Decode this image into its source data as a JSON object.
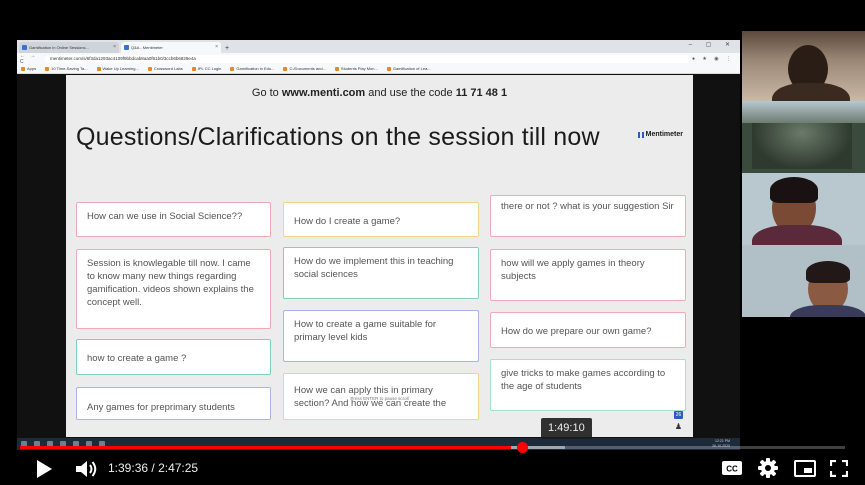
{
  "browser": {
    "tabs": [
      "Gamification in Online Sessions...",
      "Q&A - Mentimeter"
    ],
    "new_tab": "+",
    "window_controls": "–  ▢  ✕",
    "nav": "← → C",
    "url": "mentimeter.com/s/6f3da1293ac4109f9bbdcab8aa0f61b0/3ccb6b6829e4a",
    "extensions": "● ★ ◉ ⋮",
    "bookmarks": [
      "Apps",
      "10 Time-Saving Ta...",
      "Wake Up Learning...",
      "Crossword Labs",
      "IPL CC Login",
      "Gamification in Edu...",
      "C:/Documents and...",
      "Students Play Mon...",
      "Gamification of Lea..."
    ]
  },
  "slide": {
    "code_prefix": "Go to ",
    "code_site": "www.menti.com",
    "code_middle": " and use the code ",
    "code_value": "11 71 48 1",
    "title": "Questions/Clarifications on the session till now",
    "brand": "Mentimeter",
    "enter_hint": "Press ENTER to pause scroll",
    "slide_count": "26",
    "person_icon": "♟"
  },
  "cards": [
    {
      "text": "How can we use in Social Science??",
      "color": "c-red"
    },
    {
      "text": "Session is knowlegable till now. I came to know many new things regarding gamification. videos shown explains the concept well.",
      "color": "c-red"
    },
    {
      "text": "how to create a game ?",
      "color": "c-teal"
    },
    {
      "text": "Any games for preprimary students",
      "color": "c-blue"
    },
    {
      "text": "How do I create a game?",
      "color": "c-yellow"
    },
    {
      "text": "How do we implement this in teaching social sciences",
      "color": "c-teal"
    },
    {
      "text": "How to create a game suitable for primary level kids",
      "color": "c-blue"
    },
    {
      "text": "How we can apply this in primary section? And how we can create the",
      "color": "c-yellow"
    },
    {
      "text": "there or not ? what is your suggestion Sir",
      "color": "c-red"
    },
    {
      "text": "how will we apply games in theory subjects",
      "color": "c-red"
    },
    {
      "text": "How do we prepare our own game?",
      "color": "c-red"
    },
    {
      "text": "give tricks to make games according to the age of students",
      "color": "c-mint"
    }
  ],
  "taskbar": {
    "clock": "12:21 PM\n26-10-2020"
  },
  "player": {
    "hover_time": "1:49:10",
    "current_time": "1:39:36",
    "separator": " / ",
    "duration": "2:47:25",
    "played_fraction": 0.5954,
    "buffered_fraction": 0.66,
    "cc_label": "CC",
    "colors": {
      "progress": "#ff0000",
      "text": "#eeeeee"
    }
  }
}
